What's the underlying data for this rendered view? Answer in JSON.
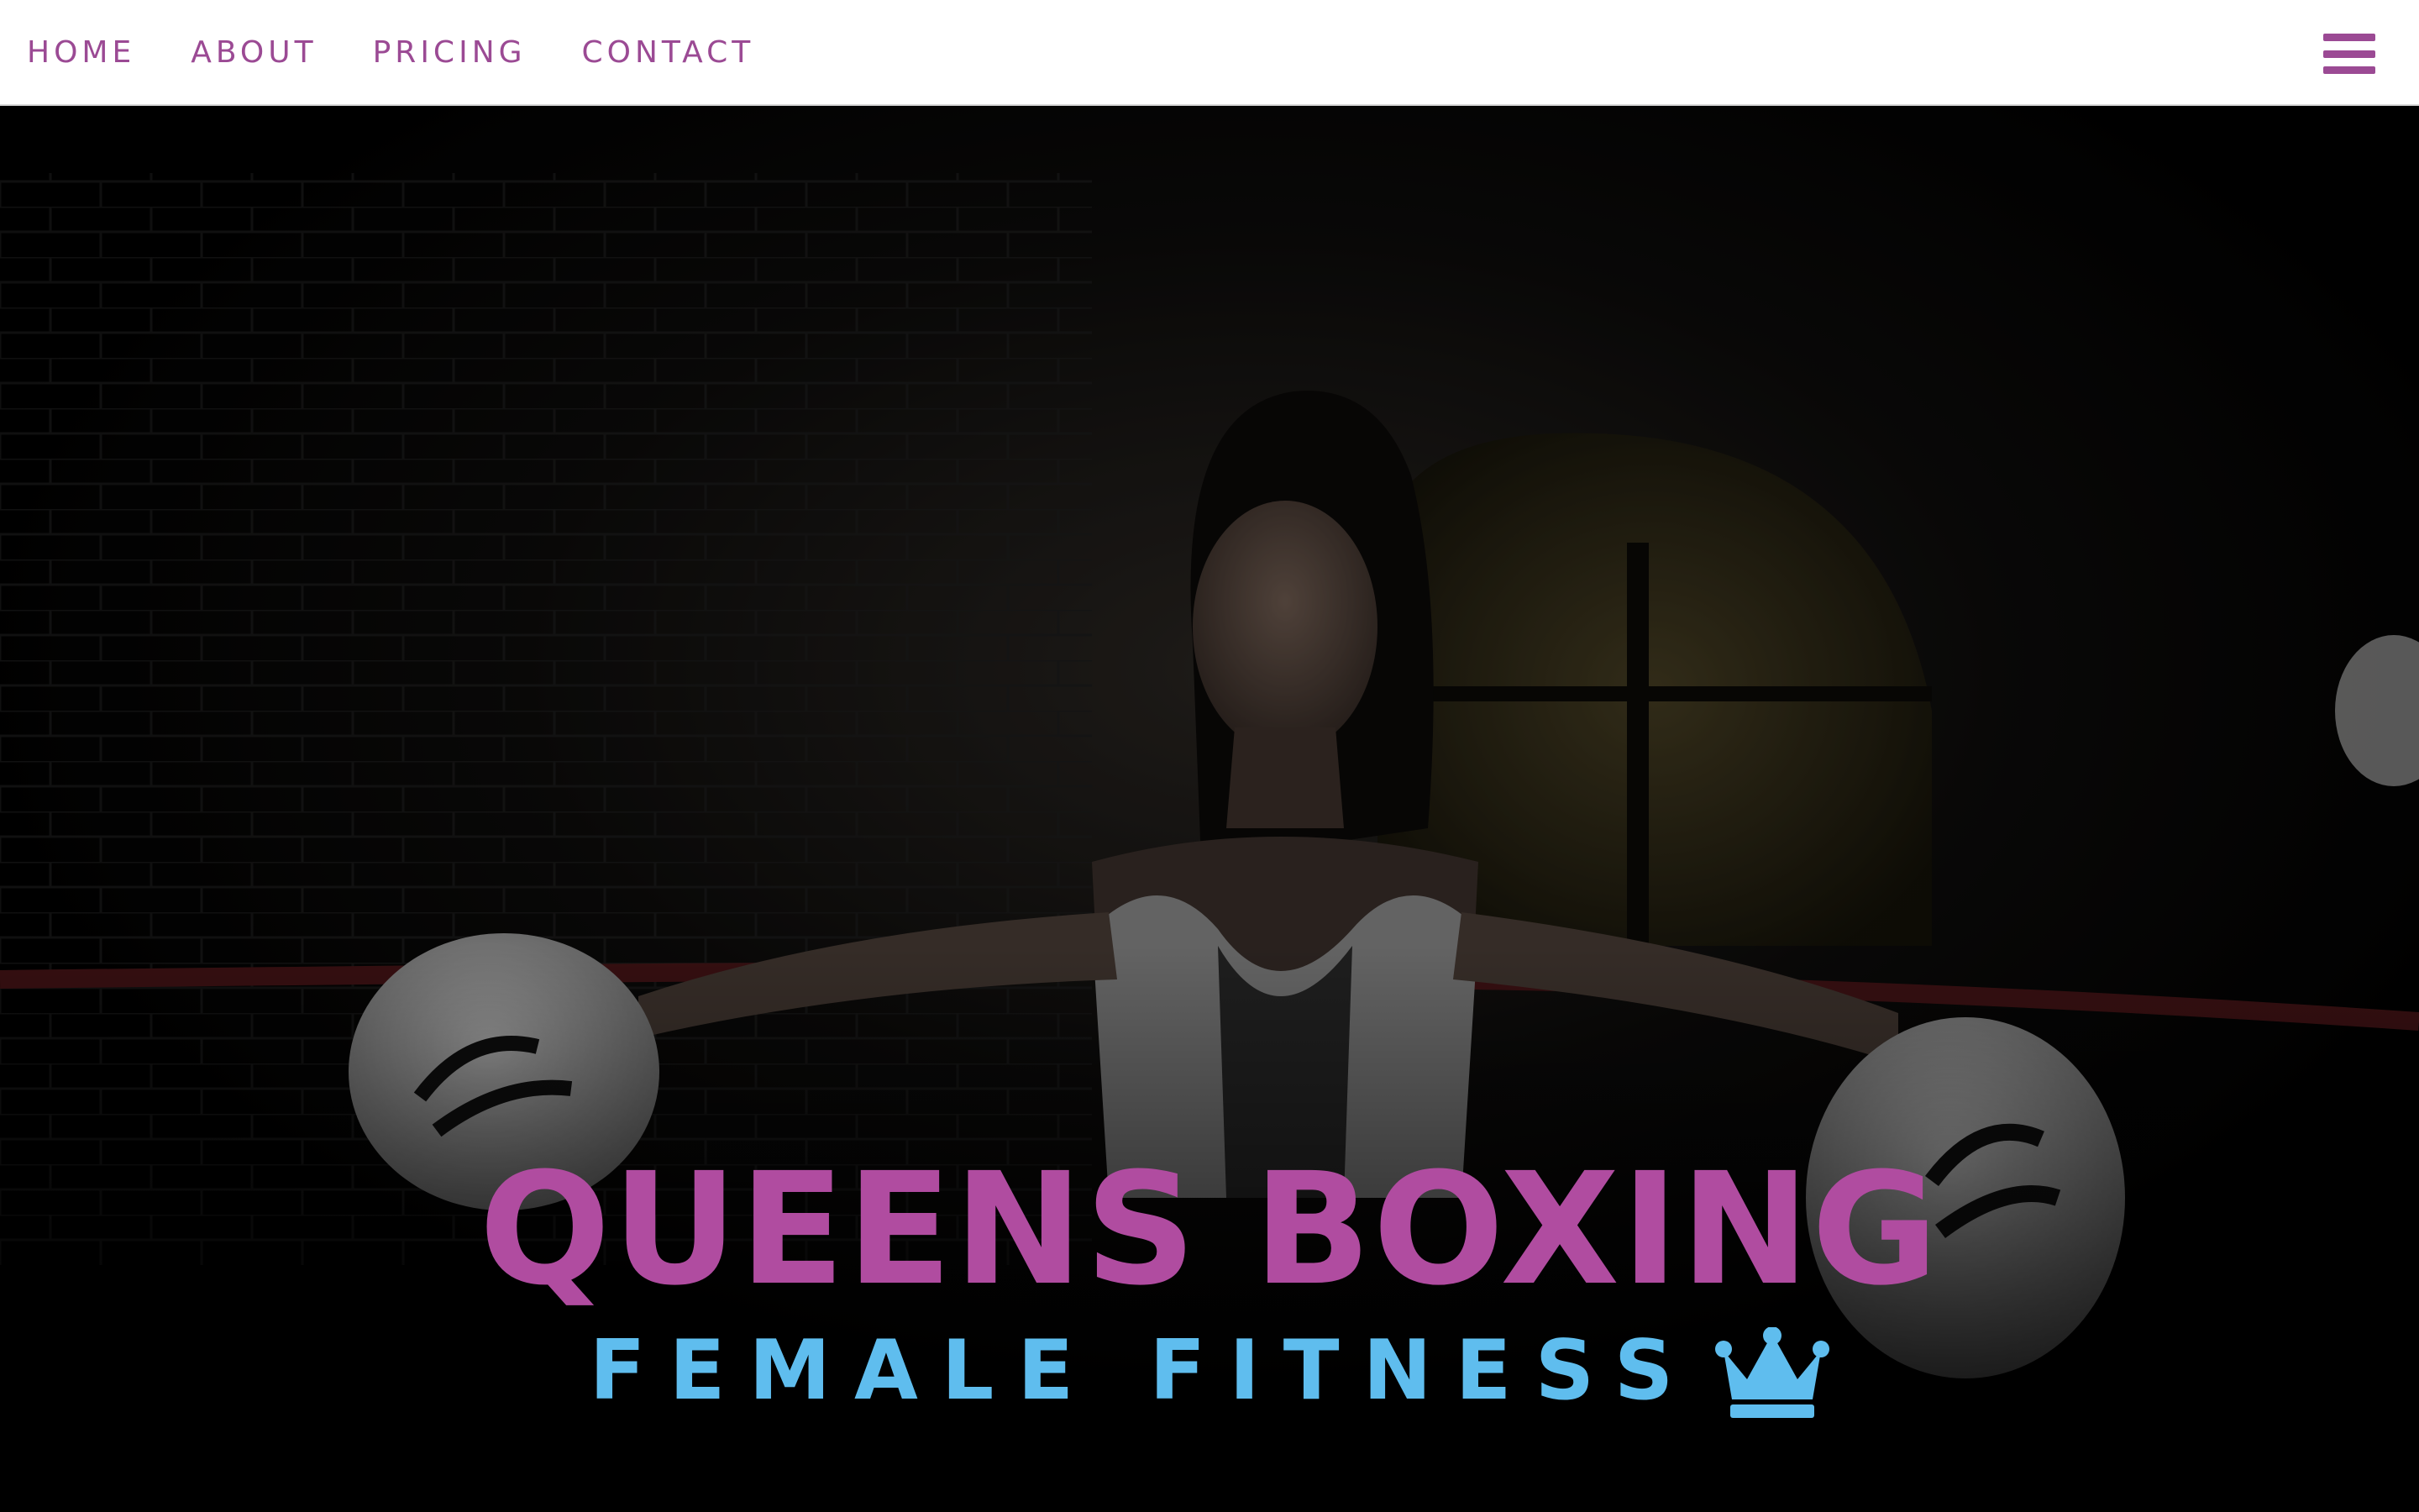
{
  "nav": {
    "items": [
      {
        "label": "HOME"
      },
      {
        "label": "ABOUT"
      },
      {
        "label": "PRICING"
      },
      {
        "label": "CONTACT"
      }
    ],
    "menu_icon": "hamburger-menu-icon"
  },
  "hero": {
    "title": "QUEENS BOXING",
    "subtitle": "FEMALE FITNESS",
    "subtitle_icon": "crown-icon",
    "background": "photo of a female boxer with white gloves leaning on ring ropes"
  },
  "colors": {
    "nav_bg": "#ffffff",
    "nav_text": "#9b4a94",
    "title": "#b04ca0",
    "subtitle": "#5fbdee",
    "hero_bg": "#000000"
  }
}
